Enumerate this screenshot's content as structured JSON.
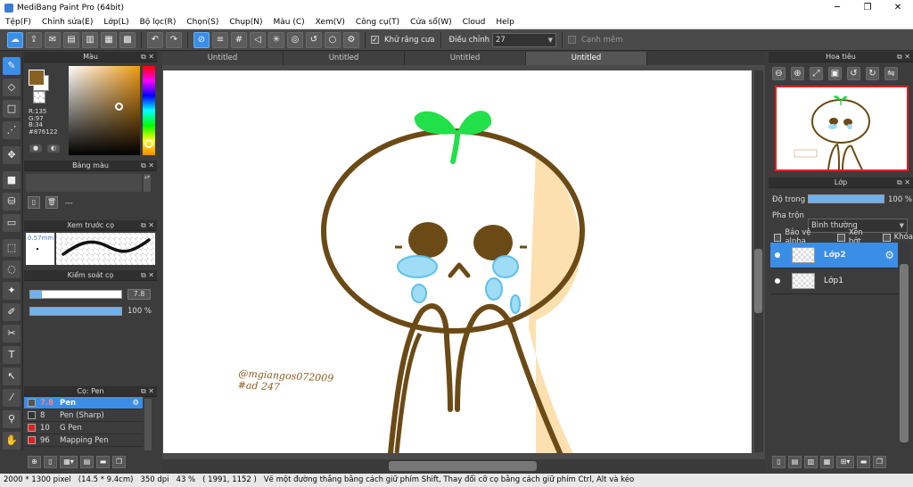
{
  "app": {
    "title": "MediBang Paint Pro (64bit)"
  },
  "window_buttons": [
    "─",
    "❐",
    "✕"
  ],
  "menu": [
    "Tệp(F)",
    "Chỉnh sửa(E)",
    "Lớp(L)",
    "Bộ lọc(R)",
    "Chọn(S)",
    "Chụp(N)",
    "Màu (C)",
    "Xem(V)",
    "Công cụ(T)",
    "Cửa sổ(W)",
    "Cloud",
    "Help"
  ],
  "toolbar": {
    "antialias_label": "Khử răng cưa",
    "adjust_label": "Điều chỉnh",
    "adjust_value": "27",
    "smooth_label": "Cạnh mềm"
  },
  "color_panel": {
    "title": "Màu",
    "rgb": [
      "R:135",
      "G:97",
      "B:34",
      "#876122"
    ],
    "main_color": "#876122"
  },
  "palette_panel": {
    "title": "Bảng màu",
    "empty_label": "---"
  },
  "brush_preview_panel": {
    "title": "Xem trước cọ",
    "size_label": "0.57mm"
  },
  "brush_control_panel": {
    "title": "Kiểm soát cọ",
    "size_value": "7.8",
    "opacity_value": "100 %",
    "size_fraction": 0.13,
    "opacity_fraction": 1.0
  },
  "brush_list_panel": {
    "title": "Cọ: Pen",
    "items": [
      {
        "size": "7.8",
        "name": "Pen",
        "color": "#555555",
        "selected": true
      },
      {
        "size": "8",
        "name": "Pen (Sharp)",
        "color": "#333333",
        "selected": false
      },
      {
        "size": "10",
        "name": "G Pen",
        "color": "#e02020",
        "selected": false
      },
      {
        "size": "96",
        "name": "Mapping Pen",
        "color": "#e02020",
        "selected": false
      }
    ]
  },
  "tabs": [
    "Untitled",
    "Untitled",
    "Untitled",
    "Untitled"
  ],
  "navigator_panel": {
    "title": "Hoa tiêu"
  },
  "layer_panel": {
    "title": "Lớp",
    "opacity_label": "Độ trong",
    "opacity_value": "100 %",
    "opacity_fraction": 1.0,
    "blend_label": "Pha trộn",
    "blend_value": "Bình thường",
    "protect_alpha": "Bảo vệ alpha",
    "clipping": "Xén bớt",
    "lock": "Khóa",
    "layers": [
      {
        "name": "Lớp2",
        "selected": true
      },
      {
        "name": "Lớp1",
        "selected": false
      }
    ]
  },
  "canvas": {
    "signature_line1": "@mgiangos072009",
    "signature_line2": "#ad 247"
  },
  "status": {
    "size_px": "2000 * 1300 pixel",
    "size_cm": "(14.5 * 9.4cm)",
    "dpi": "350 dpi",
    "zoom": "43 %",
    "coords": "( 1991, 1152 )",
    "hint": "Vẽ một đường thẳng bằng cách giữ phím Shift, Thay đổi cỡ cọ bằng cách giữ phím Ctrl, Alt và kéo"
  },
  "colors": {
    "accent": "#3b8ee6",
    "outline": "#6b4a16",
    "sprout": "#22e04a",
    "tears": "#9fdcf5",
    "cheek": "#fde0b0"
  }
}
